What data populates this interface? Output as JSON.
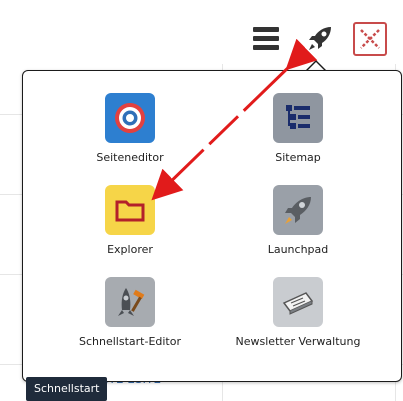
{
  "topbar": {
    "menu_icon": "hamburger-menu-icon",
    "launch_icon": "rocket-icon",
    "close_icon": "close-x-icon"
  },
  "popup": {
    "items": [
      {
        "label": "Seiteneditor",
        "icon": "target-icon"
      },
      {
        "label": "Sitemap",
        "icon": "sitemap-icon"
      },
      {
        "label": "Explorer",
        "icon": "folder-icon"
      },
      {
        "label": "Launchpad",
        "icon": "rocket-icon"
      },
      {
        "label": "Schnellstart-Editor",
        "icon": "rocket-hammer-icon"
      },
      {
        "label": "Newsletter Verwaltung",
        "icon": "newsletter-icon"
      }
    ]
  },
  "tooltip": {
    "text": "Schnellstart"
  },
  "background": {
    "partial_link_text": "ITE ESITE"
  },
  "colors": {
    "annotation_arrow": "#e11b1b",
    "tooltip_bg": "#1f2b3b",
    "folder_bg": "#f6d548"
  }
}
